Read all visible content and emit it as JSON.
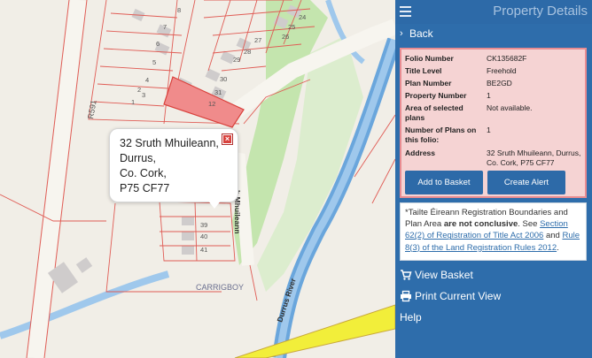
{
  "header": {
    "title": "Property Details",
    "menu_icon": "hamburger-icon"
  },
  "nav": {
    "back_label": "Back"
  },
  "property": {
    "rows": [
      {
        "key": "Folio Number",
        "value": "CK135682F"
      },
      {
        "key": "Title Level",
        "value": "Freehold"
      },
      {
        "key": "Plan Number",
        "value": "BE2GD"
      },
      {
        "key": "Property Number",
        "value": "1"
      },
      {
        "key": "Area of selected plans",
        "value": "Not available."
      },
      {
        "key": "Number of Plans on this folio:",
        "value": "1"
      },
      {
        "key": "Address",
        "value": "32 Sruth Mhuileann, Durrus, Co. Cork, P75 CF77"
      }
    ],
    "add_to_basket_label": "Add to Basket",
    "create_alert_label": "Create Alert"
  },
  "disclaimer": {
    "prefix": "*Tailte Éireann Registration Boundaries and Plan Area ",
    "bold": "are not conclusive",
    "mid1": ". See ",
    "link1": "Section 62(2) of Registration of Title Act 2006",
    "mid2": " and ",
    "link2": "Rule 8(3) of the Land Registration Rules 2012",
    "suffix": "."
  },
  "menu": {
    "view_basket": "View Basket",
    "print_view": "Print Current View",
    "help": "Help"
  },
  "map": {
    "popup_lines": [
      "32 Sruth Mhuileann,",
      "Durrus,",
      "Co. Cork,",
      "P75 CF77"
    ],
    "labels": {
      "road_r591": "R591",
      "carrigboy": "CARRIGBOY",
      "durrus_river": "Durrus River",
      "sruth_mhuileann_partial": "h Mhuileann"
    },
    "plot_numbers": [
      "8",
      "7",
      "6",
      "5",
      "4",
      "3",
      "2",
      "1",
      "24",
      "25",
      "26",
      "27",
      "28",
      "29",
      "30",
      "31",
      "12",
      "39",
      "40",
      "41"
    ]
  },
  "colors": {
    "sidebar": "#2e6dab",
    "selected_parcel": "#f08b8b",
    "details_bg": "#f5d3d3",
    "river": "#6aa6dc",
    "road": "#f2ee3a"
  }
}
